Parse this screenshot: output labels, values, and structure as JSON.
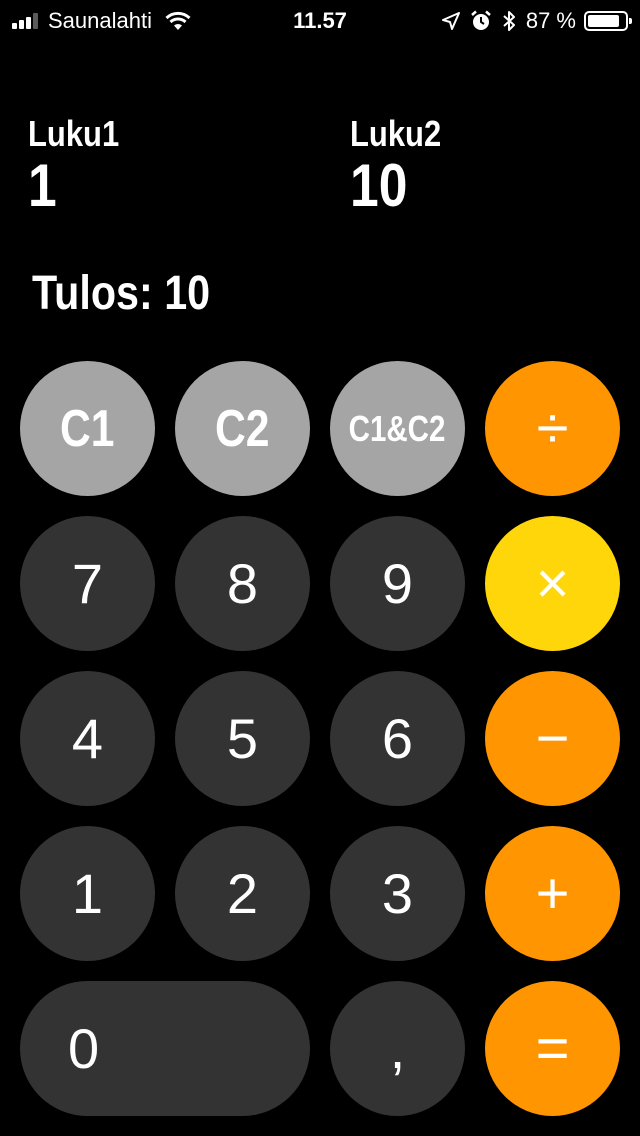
{
  "status_bar": {
    "carrier": "Saunalahti",
    "time": "11.57",
    "battery_percent": "87 %",
    "battery_level": 0.87,
    "signal_bars_filled": 3,
    "signal_bars_total": 4
  },
  "display": {
    "luku1": {
      "label": "Luku1",
      "value": "1"
    },
    "luku2": {
      "label": "Luku2",
      "value": "10"
    },
    "result": "Tulos: 10"
  },
  "keypad": {
    "clear": [
      "C1",
      "C2",
      "C1&C2"
    ],
    "divide": "÷",
    "multiply": "×",
    "subtract": "−",
    "add": "+",
    "equals": "=",
    "digits": [
      "7",
      "8",
      "9",
      "4",
      "5",
      "6",
      "1",
      "2",
      "3",
      "0"
    ],
    "comma": ","
  },
  "colors": {
    "background": "#000000",
    "digit_key": "#333333",
    "clear_key": "#a5a5a5",
    "operator_key": "#ff9500",
    "active_operator_key": "#ffd60a"
  },
  "active_operator": "multiply"
}
